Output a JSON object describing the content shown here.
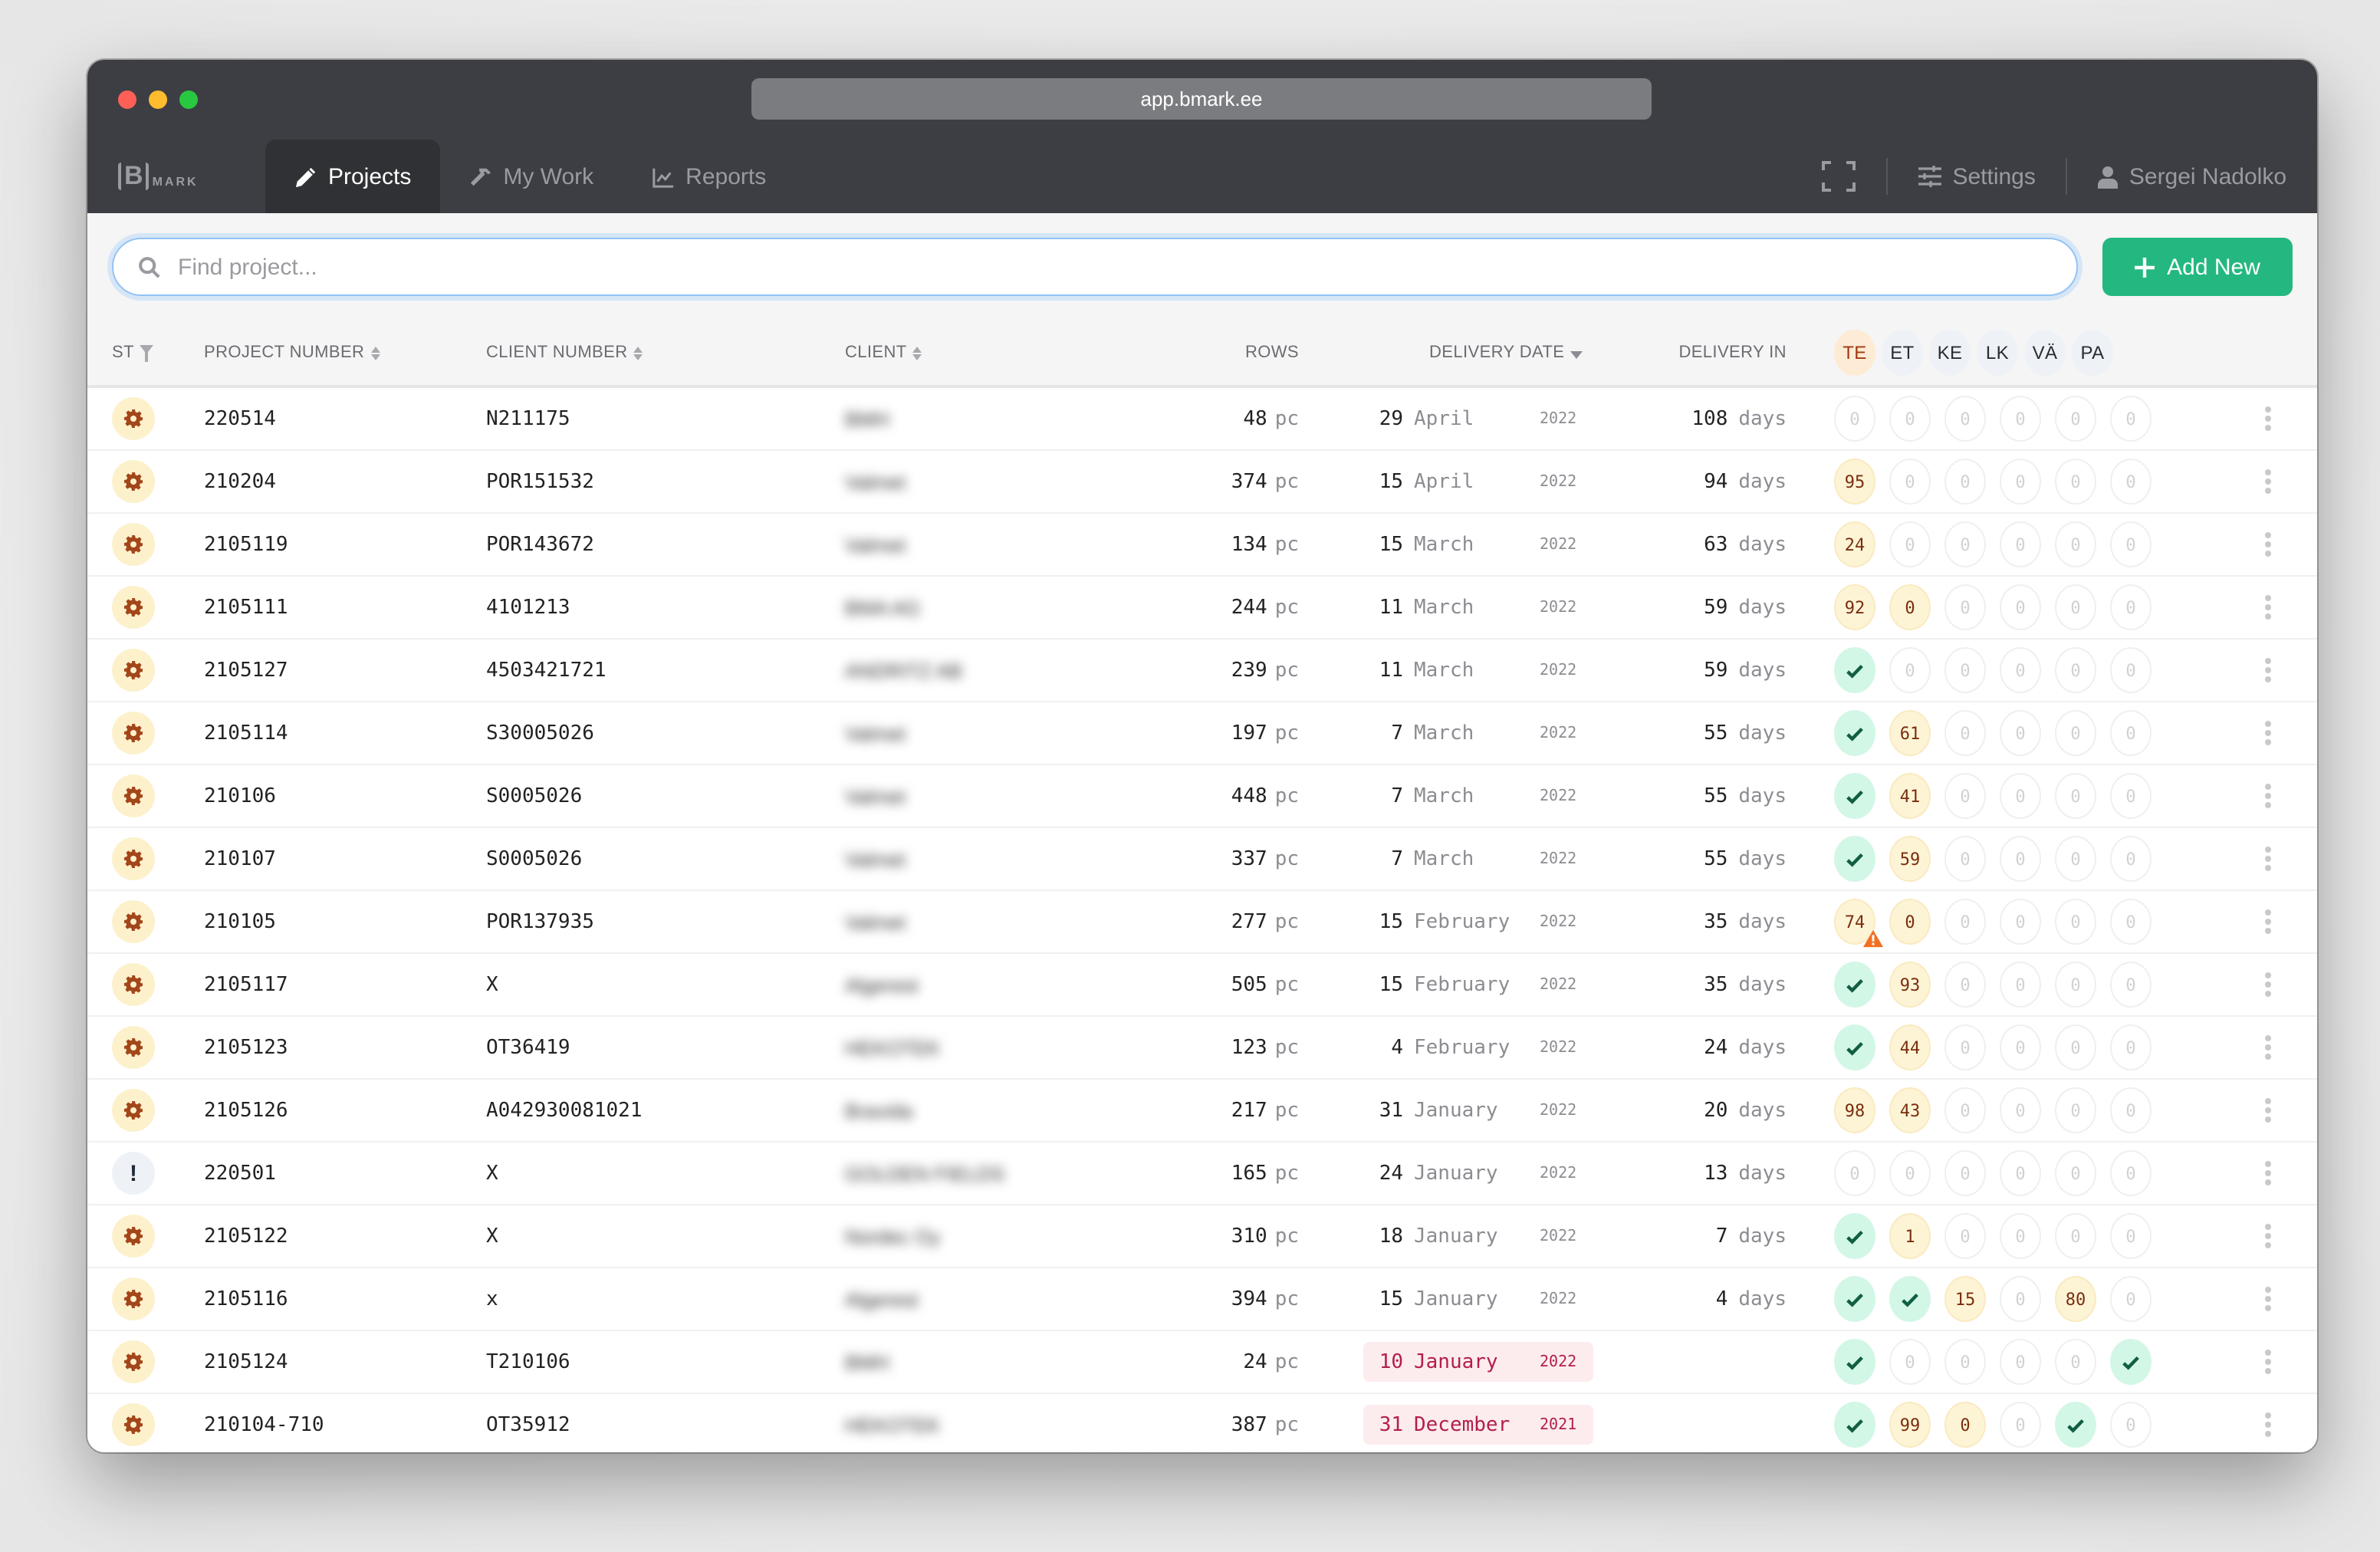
{
  "browser": {
    "url": "app.bmark.ee"
  },
  "nav": {
    "logo_letter": "B",
    "logo_text": "MARK",
    "tabs": [
      {
        "label": "Projects",
        "icon": "pencil-icon",
        "active": true
      },
      {
        "label": "My Work",
        "icon": "hammer-icon",
        "active": false
      },
      {
        "label": "Reports",
        "icon": "chart-icon",
        "active": false
      }
    ],
    "settings_label": "Settings",
    "user_name": "Sergei Nadolko"
  },
  "toolbar": {
    "search_placeholder": "Find project...",
    "search_value": "",
    "add_new_label": "Add New"
  },
  "table": {
    "headers": {
      "status": "ST",
      "project_number": "PROJECT NUMBER",
      "client_number": "CLIENT NUMBER",
      "client": "CLIENT",
      "rows": "ROWS",
      "delivery_date": "DELIVERY DATE",
      "delivery_in": "DELIVERY IN",
      "phases": [
        "TE",
        "ET",
        "KE",
        "LK",
        "VÄ",
        "PA"
      ]
    },
    "active_phase": "TE",
    "rows_unit": "pc",
    "days_unit": "days",
    "rows": [
      {
        "status": "in-progress",
        "project_number": "220514",
        "client_number": "N211175",
        "client": "BMH",
        "rows": "48",
        "day": "29",
        "month": "April",
        "year": "2022",
        "overdue": false,
        "delivery_in": "108",
        "phases": [
          "0",
          "0",
          "0",
          "0",
          "0",
          "0"
        ]
      },
      {
        "status": "in-progress",
        "project_number": "210204",
        "client_number": "POR151532",
        "client": "Valmet",
        "rows": "374",
        "day": "15",
        "month": "April",
        "year": "2022",
        "overdue": false,
        "delivery_in": "94",
        "phases": [
          "95",
          "0",
          "0",
          "0",
          "0",
          "0"
        ]
      },
      {
        "status": "in-progress",
        "project_number": "2105119",
        "client_number": "POR143672",
        "client": "Valmet",
        "rows": "134",
        "day": "15",
        "month": "March",
        "year": "2022",
        "overdue": false,
        "delivery_in": "63",
        "phases": [
          "24",
          "0",
          "0",
          "0",
          "0",
          "0"
        ]
      },
      {
        "status": "in-progress",
        "project_number": "2105111",
        "client_number": "4101213",
        "client": "BMA AG",
        "rows": "244",
        "day": "11",
        "month": "March",
        "year": "2022",
        "overdue": false,
        "delivery_in": "59",
        "phases": [
          "92",
          "0p",
          "0",
          "0",
          "0",
          "0"
        ]
      },
      {
        "status": "in-progress",
        "project_number": "2105127",
        "client_number": "4503421721",
        "client": "ANDRITZ AB",
        "rows": "239",
        "day": "11",
        "month": "March",
        "year": "2022",
        "overdue": false,
        "delivery_in": "59",
        "phases": [
          "done",
          "0",
          "0",
          "0",
          "0",
          "0"
        ]
      },
      {
        "status": "in-progress",
        "project_number": "2105114",
        "client_number": "S30005026",
        "client": "Valmet",
        "rows": "197",
        "day": "7",
        "month": "March",
        "year": "2022",
        "overdue": false,
        "delivery_in": "55",
        "phases": [
          "done",
          "61",
          "0",
          "0",
          "0",
          "0"
        ]
      },
      {
        "status": "in-progress",
        "project_number": "210106",
        "client_number": "S0005026",
        "client": "Valmet",
        "rows": "448",
        "day": "7",
        "month": "March",
        "year": "2022",
        "overdue": false,
        "delivery_in": "55",
        "phases": [
          "done",
          "41",
          "0",
          "0",
          "0",
          "0"
        ]
      },
      {
        "status": "in-progress",
        "project_number": "210107",
        "client_number": "S0005026",
        "client": "Valmet",
        "rows": "337",
        "day": "7",
        "month": "March",
        "year": "2022",
        "overdue": false,
        "delivery_in": "55",
        "phases": [
          "done",
          "59",
          "0",
          "0",
          "0",
          "0"
        ]
      },
      {
        "status": "in-progress",
        "project_number": "210105",
        "client_number": "POR137935",
        "client": "Valmet",
        "rows": "277",
        "day": "15",
        "month": "February",
        "year": "2022",
        "overdue": false,
        "delivery_in": "35",
        "phases": [
          "74!",
          "0p",
          "0",
          "0",
          "0",
          "0"
        ]
      },
      {
        "status": "in-progress",
        "project_number": "2105117",
        "client_number": "X",
        "client": "Algerest",
        "rows": "505",
        "day": "15",
        "month": "February",
        "year": "2022",
        "overdue": false,
        "delivery_in": "35",
        "phases": [
          "done",
          "93",
          "0",
          "0",
          "0",
          "0"
        ]
      },
      {
        "status": "in-progress",
        "project_number": "2105123",
        "client_number": "OT36419",
        "client": "HEKOTEK",
        "rows": "123",
        "day": "4",
        "month": "February",
        "year": "2022",
        "overdue": false,
        "delivery_in": "24",
        "phases": [
          "done",
          "44",
          "0",
          "0",
          "0",
          "0"
        ]
      },
      {
        "status": "in-progress",
        "project_number": "2105126",
        "client_number": "A042930081021",
        "client": "Bravida",
        "rows": "217",
        "day": "31",
        "month": "January",
        "year": "2022",
        "overdue": false,
        "delivery_in": "20",
        "phases": [
          "98",
          "43",
          "0",
          "0",
          "0",
          "0"
        ]
      },
      {
        "status": "alert",
        "project_number": "220501",
        "client_number": "X",
        "client": "GOLDEN FIELDS",
        "rows": "165",
        "day": "24",
        "month": "January",
        "year": "2022",
        "overdue": false,
        "delivery_in": "13",
        "phases": [
          "0",
          "0",
          "0",
          "0",
          "0",
          "0"
        ]
      },
      {
        "status": "in-progress",
        "project_number": "2105122",
        "client_number": "X",
        "client": "Nordec Oy",
        "rows": "310",
        "day": "18",
        "month": "January",
        "year": "2022",
        "overdue": false,
        "delivery_in": "7",
        "phases": [
          "done",
          "1",
          "0",
          "0",
          "0",
          "0"
        ]
      },
      {
        "status": "in-progress",
        "project_number": "2105116",
        "client_number": "x",
        "client": "Algerest",
        "rows": "394",
        "day": "15",
        "month": "January",
        "year": "2022",
        "overdue": false,
        "delivery_in": "4",
        "phases": [
          "done",
          "done",
          "15",
          "0",
          "80",
          "0"
        ]
      },
      {
        "status": "in-progress",
        "project_number": "2105124",
        "client_number": "T210106",
        "client": "BMH",
        "rows": "24",
        "day": "10",
        "month": "January",
        "year": "2022",
        "overdue": true,
        "delivery_in": "",
        "phases": [
          "done",
          "0",
          "0",
          "0",
          "0",
          "done"
        ]
      },
      {
        "status": "in-progress",
        "project_number": "210104-710",
        "client_number": "OT35912",
        "client": "HEKOTEK",
        "rows": "387",
        "day": "31",
        "month": "December",
        "year": "2021",
        "overdue": true,
        "delivery_in": "",
        "phases": [
          "done",
          "99",
          "0p",
          "0",
          "done",
          "0"
        ]
      }
    ]
  },
  "colors": {
    "accent_green": "#24b880",
    "progress_bg": "#fdf4d6",
    "done_bg": "#d3f7e6",
    "overdue_text": "#b3204a",
    "warning": "#f26f23"
  }
}
